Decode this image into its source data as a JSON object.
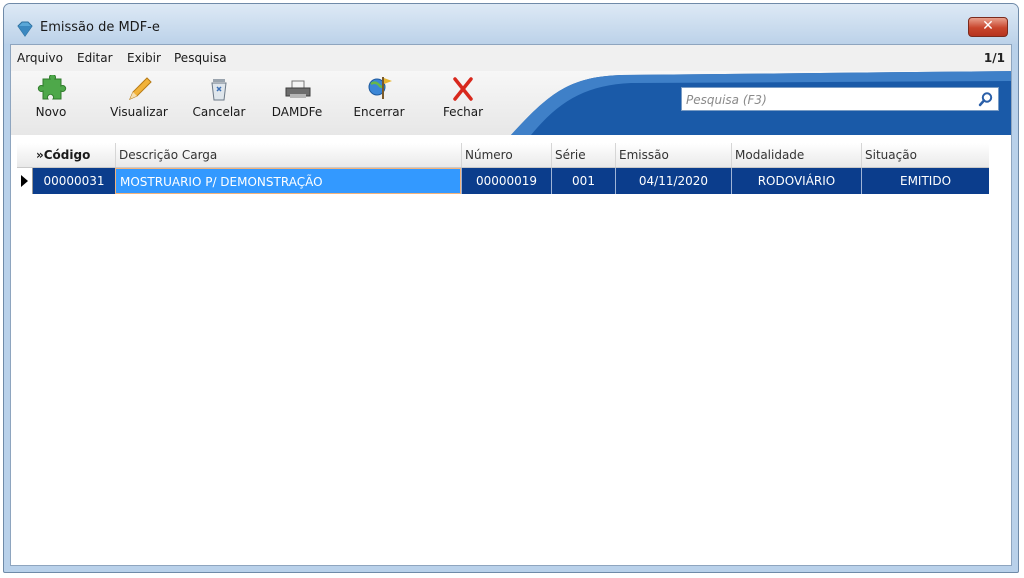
{
  "window": {
    "title": "Emissão de MDF-e",
    "close_label": "✕"
  },
  "menu": {
    "items": [
      "Arquivo",
      "Editar",
      "Exibir",
      "Pesquisa"
    ],
    "page_counter": "1/1"
  },
  "toolbar": {
    "buttons": [
      {
        "label": "Novo",
        "icon": "puzzle-add-icon"
      },
      {
        "label": "Visualizar",
        "icon": "pencil-icon"
      },
      {
        "label": "Cancelar",
        "icon": "trash-icon"
      },
      {
        "label": "DAMDFe",
        "icon": "printer-icon"
      },
      {
        "label": "Encerrar",
        "icon": "globe-finish-icon"
      },
      {
        "label": "Fechar",
        "icon": "close-x-icon"
      }
    ]
  },
  "search": {
    "placeholder": "Pesquisa (F3)",
    "value": ""
  },
  "grid": {
    "columns": [
      "»Código",
      "Descrição Carga",
      "Número",
      "Série",
      "Emissão",
      "Modalidade",
      "Situação"
    ],
    "rows": [
      [
        "00000031",
        "MOSTRUARIO P/ DEMONSTRAÇÃO",
        "00000019",
        "001",
        "04/11/2020",
        "RODOVIÁRIO",
        "EMITIDO"
      ]
    ]
  },
  "colors": {
    "selected_row": "#0b3d8c",
    "focused_cell": "#3399ff",
    "swoosh": "#1a5aa8"
  }
}
